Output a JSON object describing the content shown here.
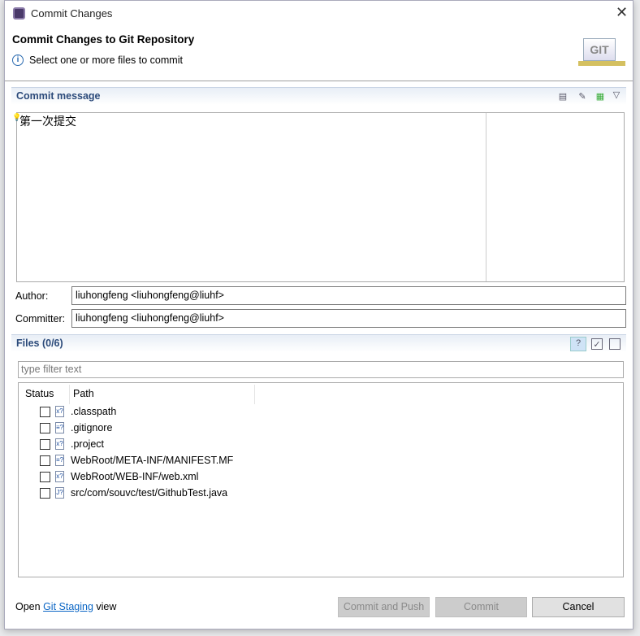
{
  "window": {
    "title": "Commit Changes"
  },
  "banner": {
    "title": "Commit Changes to Git Repository",
    "message": "Select one or more files to commit",
    "logo_text": "GIT"
  },
  "commit_message": {
    "section_title": "Commit message",
    "value": "第一次提交"
  },
  "author": {
    "label": "Author:",
    "value": "liuhongfeng <liuhongfeng@liuhf>"
  },
  "committer": {
    "label": "Committer:",
    "value": "liuhongfeng <liuhongfeng@liuhf>"
  },
  "files": {
    "section_title": "Files (0/6)",
    "filter_placeholder": "type filter text",
    "columns": [
      "Status",
      "Path"
    ],
    "rows": [
      {
        "path": ".classpath",
        "icon": "xml-file-icon",
        "checked": false
      },
      {
        "path": ".gitignore",
        "icon": "text-file-icon",
        "checked": false
      },
      {
        "path": ".project",
        "icon": "xml-file-icon",
        "checked": false
      },
      {
        "path": "WebRoot/META-INF/MANIFEST.MF",
        "icon": "text-file-icon",
        "checked": false
      },
      {
        "path": "WebRoot/WEB-INF/web.xml",
        "icon": "xml-file-icon",
        "checked": false
      },
      {
        "path": "src/com/souvc/test/GithubTest.java",
        "icon": "java-file-icon",
        "checked": false
      }
    ]
  },
  "footer": {
    "open_prefix": "Open",
    "link": "Git Staging",
    "open_suffix": "view"
  },
  "buttons": {
    "commit_and_push": "Commit and Push",
    "commit": "Commit",
    "cancel": "Cancel"
  }
}
